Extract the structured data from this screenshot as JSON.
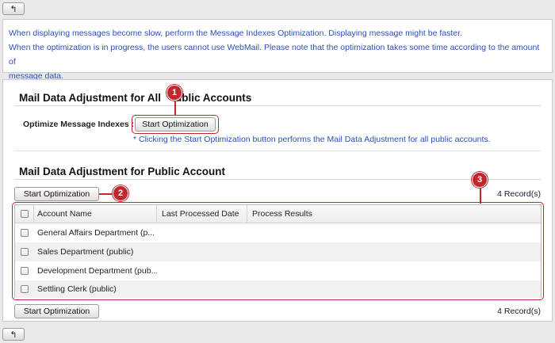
{
  "nav": {
    "back_icon": "↰"
  },
  "info": {
    "line1": "When displaying messages become slow, perform the Message Indexes Optimization. Displaying message might be faster.",
    "line2": "When the optimization is in progress, the users cannot use WebMail. Please note that the optimization takes some time according to the amount of",
    "line3": "message data."
  },
  "all_accounts": {
    "title": "Mail Data Adjustment for All Public Accounts",
    "title_visible": "Mail Data Adjustment for All",
    "title_visible_tail": "ublic Accounts",
    "optimize_label": "Optimize Message Indexes :",
    "button_label": "Start Optimization",
    "note": "* Clicking the Start Optimization button performs the Mail Data Adjustment for all public accounts."
  },
  "public_account": {
    "title": "Mail Data Adjustment for Public Account",
    "button_label": "Start Optimization",
    "record_count": "4 Record(s)",
    "columns": {
      "name": "Account Name",
      "date": "Last Processed Date",
      "results": "Process Results"
    },
    "rows": [
      {
        "name": "General Affairs Department (p...",
        "date": "",
        "results": ""
      },
      {
        "name": "Sales Department (public)",
        "date": "",
        "results": ""
      },
      {
        "name": "Development Department (pub...",
        "date": "",
        "results": ""
      },
      {
        "name": "Settling Clerk (public)",
        "date": "",
        "results": ""
      }
    ],
    "bottom_button_label": "Start Optimization",
    "bottom_record_count": "4 Record(s)"
  },
  "callouts": {
    "c1": "1",
    "c2": "2",
    "c3": "3"
  },
  "colors": {
    "accent_red": "#c1272d",
    "link_blue": "#2c4fb7"
  }
}
